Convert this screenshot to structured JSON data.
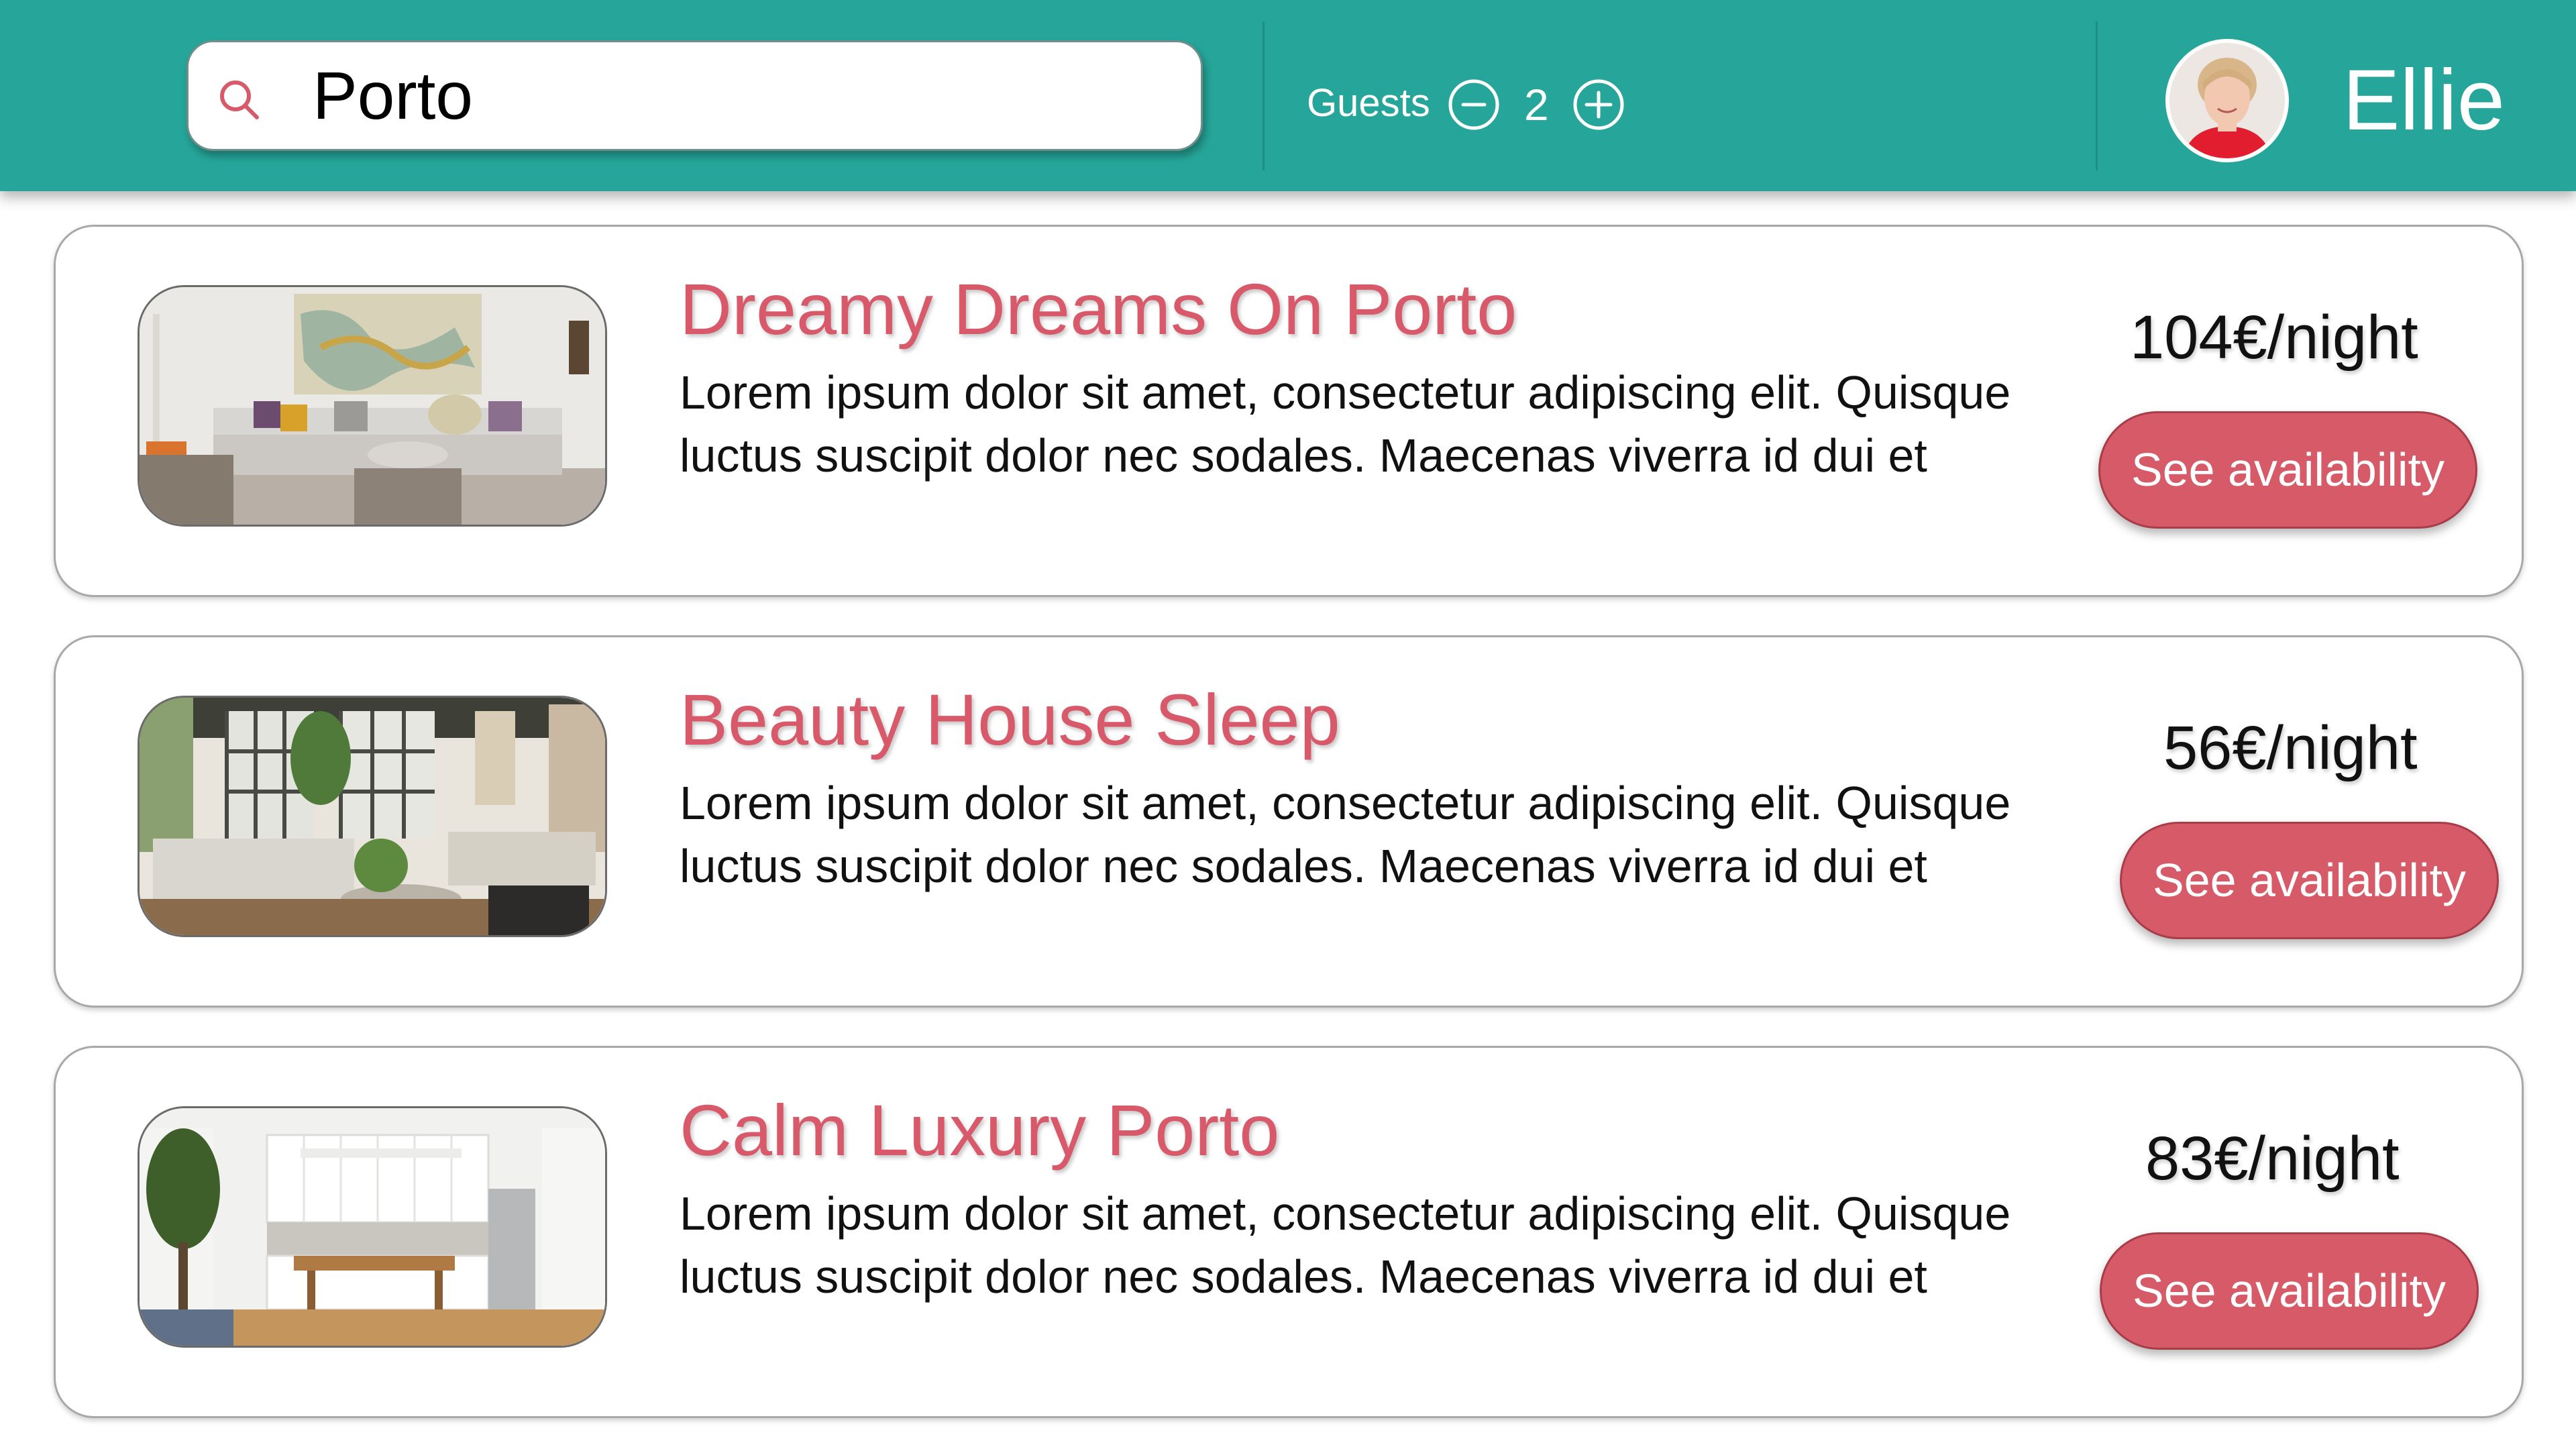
{
  "search": {
    "value": "Porto",
    "icon": "search-icon"
  },
  "guests": {
    "label": "Guests",
    "count": "2",
    "decrement_icon": "minus-circle-icon",
    "increment_icon": "plus-circle-icon"
  },
  "user": {
    "name": "Ellie",
    "avatar_icon": "avatar"
  },
  "colors": {
    "header": "#26a69a",
    "accent": "#d85a6a",
    "button": "#d65a67"
  },
  "listings": [
    {
      "title": "Dreamy Dreams On Porto",
      "description": "Lorem ipsum dolor sit amet, consectetur adipiscing elit. Quisque luctus suscipit dolor nec sodales. Maecenas viverra id dui et",
      "price": "104€/night",
      "cta": "See availability"
    },
    {
      "title": "Beauty House Sleep",
      "description": "Lorem ipsum dolor sit amet, consectetur adipiscing elit. Quisque luctus suscipit dolor nec sodales. Maecenas viverra id dui et",
      "price": "56€/night",
      "cta": "See availability"
    },
    {
      "title": "Calm Luxury Porto",
      "description": "Lorem ipsum dolor sit amet, consectetur adipiscing elit. Quisque luctus suscipit dolor nec sodales. Maecenas viverra id dui et",
      "price": "83€/night",
      "cta": "See availability"
    }
  ]
}
